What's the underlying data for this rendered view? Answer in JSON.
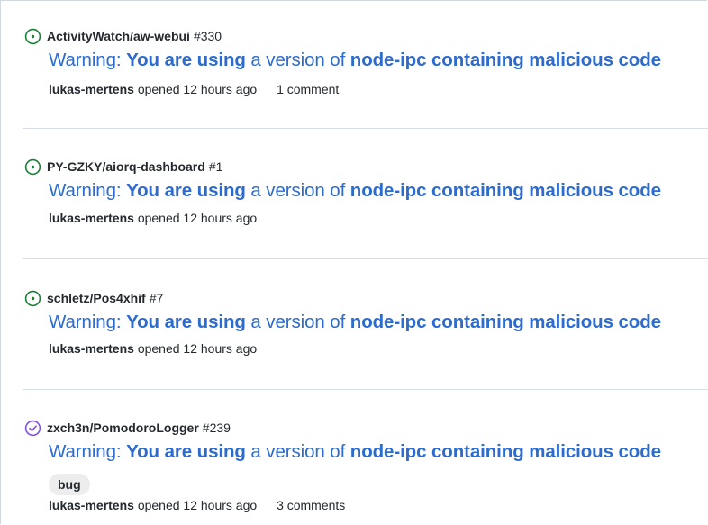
{
  "issues": [
    {
      "state": "open",
      "repo": "ActivityWatch/aw-webui",
      "number": "#330",
      "title": {
        "w1": "Warning: ",
        "b1": "You are using",
        "w2": " a version of ",
        "b2": "node-ipc containing malicious code"
      },
      "author": "lukas-mertens",
      "opened": "opened 12 hours ago",
      "comments": "1 comment"
    },
    {
      "state": "open",
      "repo": "PY-GZKY/aiorq-dashboard",
      "number": "#1",
      "title": {
        "w1": "Warning: ",
        "b1": "You are using",
        "w2": " a version of ",
        "b2": "node-ipc containing malicious code"
      },
      "author": "lukas-mertens",
      "opened": "opened 12 hours ago"
    },
    {
      "state": "open",
      "repo": "schletz/Pos4xhif",
      "number": "#7",
      "title": {
        "w1": "Warning: ",
        "b1": "You are using",
        "w2": " a version of ",
        "b2": "node-ipc containing malicious code"
      },
      "author": "lukas-mertens",
      "opened": "opened 12 hours ago"
    },
    {
      "state": "closed",
      "repo": "zxch3n/PomodoroLogger",
      "number": "#239",
      "title": {
        "w1": "Warning: ",
        "b1": "You are using",
        "w2": " a version of ",
        "b2": "node-ipc containing malicious code"
      },
      "label": "bug",
      "author": "lukas-mertens",
      "opened": "opened 12 hours ago",
      "comments": "3 comments"
    }
  ],
  "colors": {
    "open": "#1a7f37",
    "closed": "#8250df",
    "link": "#2c6bcf"
  }
}
